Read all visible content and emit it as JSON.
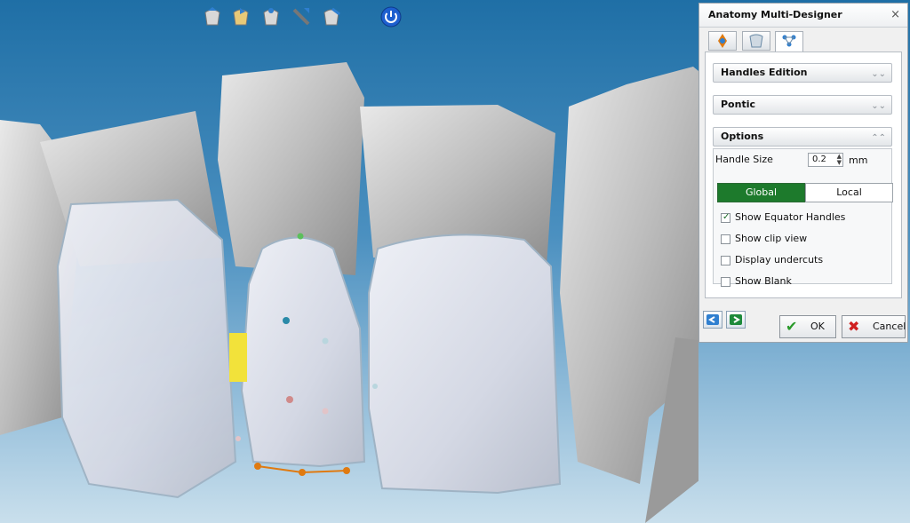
{
  "toolbar": {
    "icons": [
      "tooth-handles-icon",
      "tooth-shape-icon",
      "tooth-anchor-icon",
      "tooth-cut-icon",
      "tooth-smooth-icon",
      "power-icon"
    ]
  },
  "dialog": {
    "title": "Anatomy Multi-Designer",
    "close": "×",
    "tabs": [
      "move-tool-tab-icon",
      "shape-tool-tab-icon",
      "handles-tool-tab-icon"
    ],
    "sections": {
      "handles_edition": "Handles Edition",
      "pontic": "Pontic",
      "options": "Options"
    },
    "options": {
      "handle_size_label": "Handle Size",
      "handle_size_value": "0.2",
      "handle_size_unit": "mm",
      "mode_global": "Global",
      "mode_local": "Local",
      "show_equator_handles": "Show Equator Handles",
      "show_clip_view": "Show clip view",
      "display_undercuts": "Display undercuts",
      "show_blank": "Show Blank"
    },
    "checkbox_states": {
      "show_equator_handles": true,
      "show_clip_view": false,
      "display_undercuts": false,
      "show_blank": false
    },
    "ok_label": "OK",
    "cancel_label": "Cancel"
  },
  "colors": {
    "global_active": "#1d7a2c",
    "background_top": "#1f6fa6",
    "background_bottom": "#c9dfec",
    "handle_orange": "#e07a10"
  }
}
